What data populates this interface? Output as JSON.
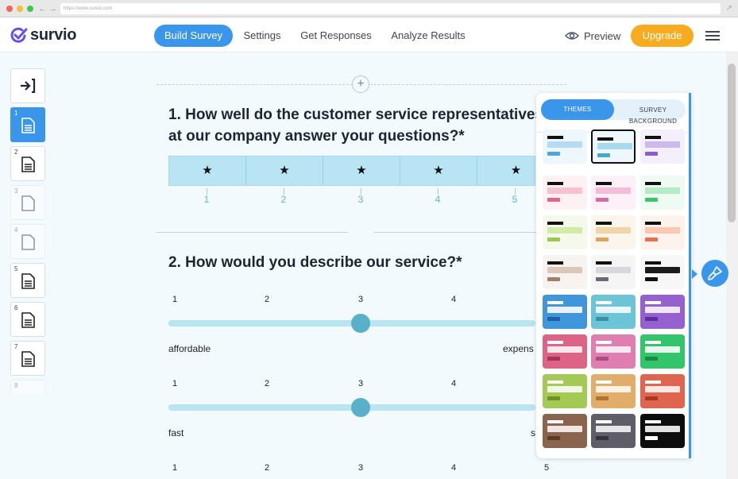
{
  "browser": {
    "url": "https://www.survio.com"
  },
  "header": {
    "logo_text": "survio",
    "tabs": [
      {
        "label": "Build Survey",
        "active": true
      },
      {
        "label": "Settings",
        "active": false
      },
      {
        "label": "Get Responses",
        "active": false
      },
      {
        "label": "Analyze Results",
        "active": false
      }
    ],
    "preview_label": "Preview",
    "upgrade_label": "Upgrade"
  },
  "sidebar": {
    "pages": [
      "1",
      "2",
      "3",
      "4",
      "5",
      "6",
      "7",
      "8"
    ]
  },
  "questions": [
    {
      "title_line1": "1. How well do the customer service representatives",
      "title_line2": "at our company answer your questions?*",
      "type": "stars",
      "star_glyph": "★",
      "scale": [
        "1",
        "2",
        "3",
        "4",
        "5"
      ]
    },
    {
      "title_line1": "2. How would you describe our service?*",
      "rows": [
        {
          "scale": [
            "1",
            "2",
            "3",
            "4"
          ],
          "left_label": "affordable",
          "right_label": "expens",
          "value": 3
        },
        {
          "scale": [
            "1",
            "2",
            "3",
            "4"
          ],
          "left_label": "fast",
          "right_label": "s",
          "value": 3
        },
        {
          "scale": [
            "1",
            "2",
            "3",
            "4",
            "5"
          ]
        }
      ]
    }
  ],
  "theme_panel": {
    "tab_themes": "THEMES",
    "tab_background_line1": "SURVEY",
    "tab_background_line2": "BACKGROUND",
    "themes": [
      {
        "bg": "#eef7fc",
        "bar": "#b5dcf2",
        "accent": "#4aa6dc",
        "title": "#111111",
        "selected": false
      },
      {
        "bg": "#eef7fb",
        "bar": "#a5dbec",
        "accent": "#45a9c3",
        "title": "#111111",
        "selected": true
      },
      {
        "bg": "#f4f0fb",
        "bar": "#cdb9ee",
        "accent": "#8a5dd1",
        "title": "#111111",
        "selected": false
      },
      {
        "bg": "#fdf1f4",
        "bar": "#f6c1d0",
        "accent": "#e0668f",
        "title": "#111111",
        "selected": false
      },
      {
        "bg": "#fdf0f6",
        "bar": "#f3bdd8",
        "accent": "#d66aa5",
        "title": "#111111",
        "selected": false
      },
      {
        "bg": "#eefbf2",
        "bar": "#b4ebc6",
        "accent": "#3cc56d",
        "title": "#111111",
        "selected": false
      },
      {
        "bg": "#f4f9ec",
        "bar": "#d3eaa8",
        "accent": "#98c949",
        "title": "#111111",
        "selected": false
      },
      {
        "bg": "#fbf5ec",
        "bar": "#f0d5aa",
        "accent": "#dea35b",
        "title": "#111111",
        "selected": false
      },
      {
        "bg": "#fdf2ec",
        "bar": "#f8c8b2",
        "accent": "#e5704f",
        "title": "#111111",
        "selected": false
      },
      {
        "bg": "#f7f3f0",
        "bar": "#dcc8b9",
        "accent": "#a57f63",
        "title": "#111111",
        "selected": false
      },
      {
        "bg": "#f5f5f6",
        "bar": "#d8d8dc",
        "accent": "#6a6a72",
        "title": "#111111",
        "selected": false
      },
      {
        "bg": "#f7f7f7",
        "bar": "#1c1c1c",
        "accent": "#111111",
        "title": "#111111",
        "selected": false
      },
      {
        "bg": "#3f96db",
        "bar": "#e8f2fb",
        "accent": "#1f5fa5",
        "title": "#ffffff",
        "selected": false
      },
      {
        "bg": "#6cc5d6",
        "bar": "#e9f7fa",
        "accent": "#3d8fa3",
        "title": "#ffffff",
        "selected": false
      },
      {
        "bg": "#9561cf",
        "bar": "#efe7f8",
        "accent": "#5d2fa0",
        "title": "#ffffff",
        "selected": false
      },
      {
        "bg": "#dd6486",
        "bar": "#fbe6ec",
        "accent": "#a73558",
        "title": "#ffffff",
        "selected": false
      },
      {
        "bg": "#df7eb1",
        "bar": "#fbe8f2",
        "accent": "#ad4a80",
        "title": "#ffffff",
        "selected": false
      },
      {
        "bg": "#33c46c",
        "bar": "#e4f8ec",
        "accent": "#1a8a45",
        "title": "#ffffff",
        "selected": false
      },
      {
        "bg": "#a4c954",
        "bar": "#f1f7e4",
        "accent": "#6f9226",
        "title": "#ffffff",
        "selected": false
      },
      {
        "bg": "#e0ad6a",
        "bar": "#fbf1e4",
        "accent": "#a9772f",
        "title": "#ffffff",
        "selected": false
      },
      {
        "bg": "#e06550",
        "bar": "#fbe6e1",
        "accent": "#a73a25",
        "title": "#ffffff",
        "selected": false
      },
      {
        "bg": "#8a644e",
        "bar": "#efe6e0",
        "accent": "#5a3b28",
        "title": "#ffffff",
        "selected": false
      },
      {
        "bg": "#5f5e68",
        "bar": "#e6e6ea",
        "accent": "#34333b",
        "title": "#ffffff",
        "selected": false
      },
      {
        "bg": "#0d0d0d",
        "bar": "#e2e2e2",
        "accent": "#ffffff",
        "title": "#ffffff",
        "selected": false
      }
    ]
  },
  "colors": {
    "accent": "#3a96ea",
    "upgrade": "#f6ac1e",
    "slider_knob": "#58b0c9",
    "star_bar": "#b9e4f3"
  }
}
